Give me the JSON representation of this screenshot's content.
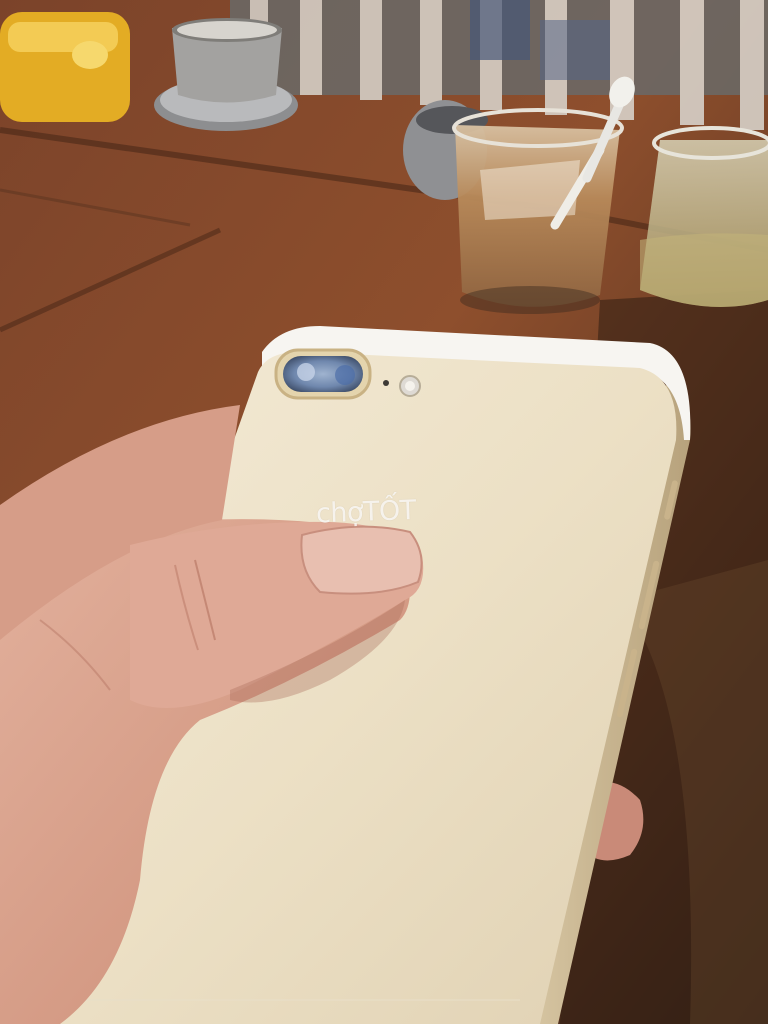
{
  "scene": {
    "subject": "gold-smartphone-back-held-in-hand",
    "watermark": {
      "text": "chợTỐT"
    }
  },
  "palette": {
    "table_wood": "#8a4a2a",
    "table_dark": "#3b2417",
    "phone_gold": "#ede0c6",
    "skin": "#d9a38f",
    "coffee": "#b98a5a",
    "ashtray_yellow": "#e8b325"
  }
}
